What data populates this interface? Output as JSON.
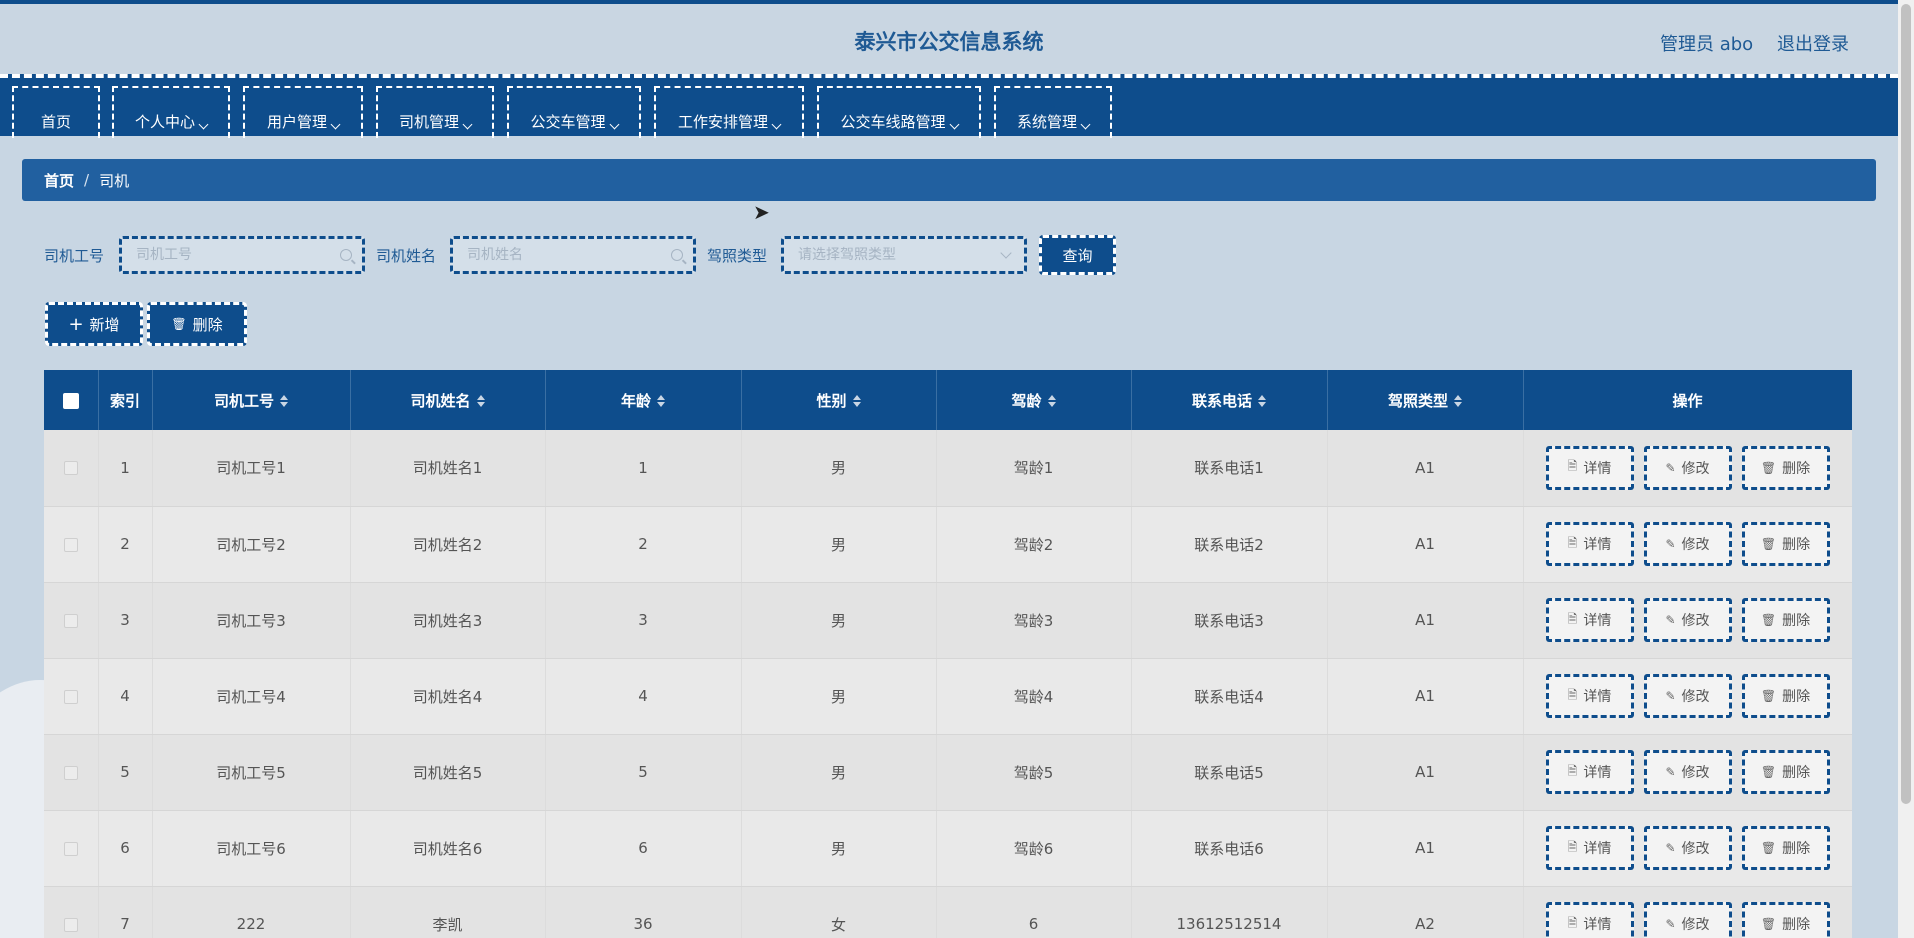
{
  "header": {
    "title": "泰兴市公交信息系统",
    "user": "管理员 abo",
    "logout": "退出登录"
  },
  "nav": [
    {
      "label": "首页",
      "dropdown": false
    },
    {
      "label": "个人中心",
      "dropdown": true
    },
    {
      "label": "用户管理",
      "dropdown": true
    },
    {
      "label": "司机管理",
      "dropdown": true
    },
    {
      "label": "公交车管理",
      "dropdown": true
    },
    {
      "label": "工作安排管理",
      "dropdown": true
    },
    {
      "label": "公交车线路管理",
      "dropdown": true
    },
    {
      "label": "系统管理",
      "dropdown": true
    }
  ],
  "breadcrumb": {
    "home": "首页",
    "sep": "/",
    "current": "司机"
  },
  "search": {
    "id_label": "司机工号",
    "id_placeholder": "司机工号",
    "name_label": "司机姓名",
    "name_placeholder": "司机姓名",
    "license_label": "驾照类型",
    "license_placeholder": "请选择驾照类型",
    "query": "查询"
  },
  "actions": {
    "add": "新增",
    "delete": "删除",
    "add_icon": "+",
    "delete_icon": "🗑"
  },
  "table": {
    "headers": [
      "索引",
      "司机工号",
      "司机姓名",
      "年龄",
      "性别",
      "驾龄",
      "联系电话",
      "驾照类型",
      "操作"
    ],
    "ops": {
      "detail": "详情",
      "edit": "修改",
      "delete": "删除"
    },
    "rows": [
      [
        "1",
        "司机工号1",
        "司机姓名1",
        "1",
        "男",
        "驾龄1",
        "联系电话1",
        "A1"
      ],
      [
        "2",
        "司机工号2",
        "司机姓名2",
        "2",
        "男",
        "驾龄2",
        "联系电话2",
        "A1"
      ],
      [
        "3",
        "司机工号3",
        "司机姓名3",
        "3",
        "男",
        "驾龄3",
        "联系电话3",
        "A1"
      ],
      [
        "4",
        "司机工号4",
        "司机姓名4",
        "4",
        "男",
        "驾龄4",
        "联系电话4",
        "A1"
      ],
      [
        "5",
        "司机工号5",
        "司机姓名5",
        "5",
        "男",
        "驾龄5",
        "联系电话5",
        "A1"
      ],
      [
        "6",
        "司机工号6",
        "司机姓名6",
        "6",
        "男",
        "驾龄6",
        "联系电话6",
        "A1"
      ],
      [
        "7",
        "222",
        "李凯",
        "36",
        "女",
        "6",
        "13612512514",
        "A2"
      ]
    ]
  },
  "colors": {
    "primary": "#0e4d8c",
    "breadcrumb": "#2160a0",
    "background": "#c8d6e3"
  }
}
